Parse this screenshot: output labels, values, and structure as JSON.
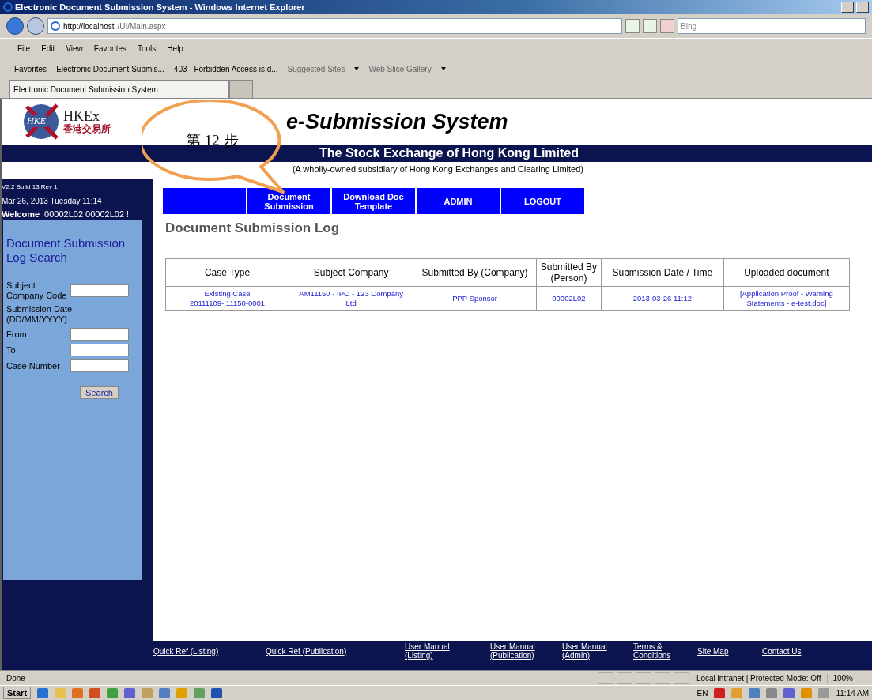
{
  "window": {
    "title": "Electronic Document Submission System - Windows Internet Explorer"
  },
  "browser": {
    "address_host": "http://localhost",
    "address_path": "/UI/Main.aspx",
    "search_placeholder": "Bing",
    "menu": [
      "File",
      "Edit",
      "View",
      "Favorites",
      "Tools",
      "Help"
    ],
    "favorites_label": "Favorites",
    "favorites_items": [
      {
        "label": "Electronic Document Submis...",
        "kind": "link"
      },
      {
        "label": "403 - Forbidden Access is d...",
        "kind": "link"
      },
      {
        "label": "Suggested Sites",
        "kind": "dropdown"
      },
      {
        "label": "Web Slice Gallery",
        "kind": "dropdown"
      }
    ],
    "tabs": [
      {
        "label": "Electronic Document Submission System",
        "selected": true
      },
      {
        "selected": false
      }
    ]
  },
  "page": {
    "logo": {
      "mark": "HKE",
      "name": "HKEx",
      "chinese": "香港交易所"
    },
    "title": "e-Submission System",
    "band_title": "The Stock Exchange of Hong Kong Limited",
    "subtitle": "(A wholly-owned subsidiary of Hong Kong Exchanges and Clearing Limited)",
    "callout": "第 12 步",
    "sidebar": {
      "version": "V2.2 Build 13 Rev 1",
      "date": "Mar 26, 2013 Tuesday 11:14",
      "welcome_label": "Welcome",
      "welcome_user": "00002L02 00002L02 !",
      "search_title": "Document Submission Log Search",
      "fields": [
        {
          "label": "Subject Company Code",
          "kind": "field"
        },
        {
          "label": "Submission Date (DD/MM/YYYY)",
          "kind": "label"
        },
        {
          "label": "From",
          "kind": "field"
        },
        {
          "label": "To",
          "kind": "field"
        },
        {
          "label": "Case Number",
          "kind": "field"
        }
      ],
      "button": "Search"
    },
    "nav": [
      "Document Submission",
      "Download Doc Template",
      "ADMIN",
      "LOGOUT"
    ],
    "heading": "Document Submission Log",
    "table": {
      "columns": [
        "Case Type",
        "Subject Company",
        "Submitted By (Company)",
        "Submitted By (Person)",
        "Submission Date / Time",
        "Uploaded document"
      ],
      "rows": [
        [
          "Existing Case\n20111109-I11150-0001",
          "AM11150 - IPO - 123 Company\nLtd",
          "PPP Sponsor",
          "00002L02",
          "2013-03-26 11:12",
          "[Application Proof - Warning\nStatements - e-test.doc]"
        ]
      ]
    },
    "footer_links": [
      "Quick Ref (Listing)",
      "Quick Ref (Publication)",
      "User Manual\n(Listing)",
      "User Manual\n(Publication)",
      "User Manual\n(Admin)",
      "Terms &\nConditions",
      "Site Map",
      "Contact Us"
    ]
  },
  "status_bar": {
    "text": "Done",
    "zone": "Local intranet | Protected Mode: Off",
    "zoom": "100%"
  },
  "taskbar": {
    "start": "Start",
    "language": "EN",
    "time": "11:14 AM"
  }
}
